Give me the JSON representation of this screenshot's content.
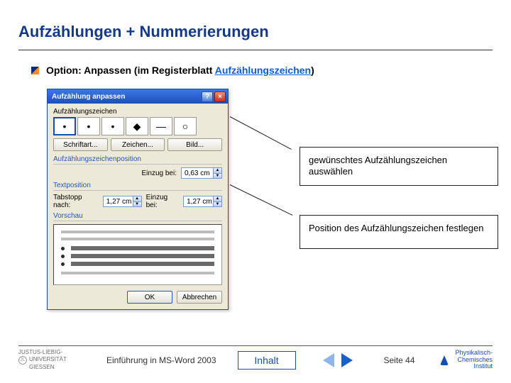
{
  "title": "Aufzählungen + Nummerierungen",
  "bullet": {
    "prefix": "Option: Anpassen (im Registerblatt ",
    "link": "Aufzählungszeichen",
    "suffix": ")"
  },
  "dialog": {
    "title": "Aufzählung anpassen",
    "section_bullet": "Aufzählungszeichen",
    "bullets": [
      "•",
      "•",
      "•",
      "◆",
      "—",
      "○"
    ],
    "btn_font": "Schriftart...",
    "btn_char": "Zeichen...",
    "btn_pic": "Bild...",
    "section_pos": "Aufzählungszeichenposition",
    "indent_at_lbl": "Einzug bei:",
    "indent_at_val": "0,63 cm",
    "section_text": "Textposition",
    "tab_after_lbl": "Tabstopp nach:",
    "tab_after_val": "1,27 cm",
    "indent2_lbl": "Einzug bei:",
    "indent2_val": "1,27 cm",
    "section_preview": "Vorschau",
    "ok": "OK",
    "cancel": "Abbrechen"
  },
  "callouts": {
    "c1": "gewünschtes Aufzählungszeichen auswählen",
    "c2": "Position des Aufzählungszeichen festlegen"
  },
  "footer": {
    "uni1": "JUSTUS-LIEBIG-",
    "uni2": "UNIVERSITÄT",
    "uni3": "GIESSEN",
    "course": "Einführung in MS-Word 2003",
    "inhalt": "Inhalt",
    "page": "Seite 44",
    "pci1": "Physikalisch-",
    "pci2": "Chemisches",
    "pci3": "Institut"
  }
}
